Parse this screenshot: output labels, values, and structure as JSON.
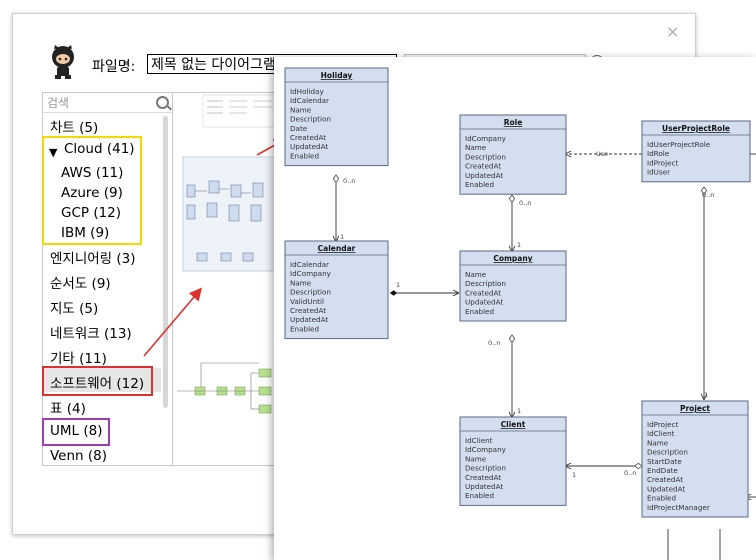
{
  "dialog": {
    "close_label": "×",
    "filename_label": "파일명:",
    "filename_value": "제목 없는 다이어그램"
  },
  "sidebar": {
    "search_placeholder": "검색",
    "items": [
      {
        "label": "차트 (5)"
      },
      {
        "label": "Cloud (41)",
        "expanded": true
      },
      {
        "label": "AWS (11)"
      },
      {
        "label": "Azure (9)"
      },
      {
        "label": "GCP (12)"
      },
      {
        "label": "IBM (9)"
      },
      {
        "label": "엔지니어링 (3)"
      },
      {
        "label": "순서도 (9)"
      },
      {
        "label": "지도 (5)"
      },
      {
        "label": "네트워크 (13)"
      },
      {
        "label": "기타 (11)"
      },
      {
        "label": "소프트웨어 (12)"
      },
      {
        "label": "표 (4)"
      },
      {
        "label": "UML (8)"
      },
      {
        "label": "Venn (8)"
      }
    ]
  },
  "colors": {
    "highlight_yellow": "#f5d800",
    "highlight_red": "#e0302e",
    "highlight_purple": "#9b3fb0",
    "entity_fill": "#d3deef",
    "entity_border": "#5a6a86",
    "arrow": "#e0302e"
  },
  "diagram": {
    "entities": [
      {
        "title": "Holiday",
        "attrs": [
          "IdHoliday",
          "IdCalendar",
          "Name",
          "Description",
          "Date",
          "CreatedAt",
          "UpdatedAt",
          "Enabled"
        ]
      },
      {
        "title": "Role",
        "attrs": [
          "IdCompany",
          "Name",
          "Description",
          "CreatedAt",
          "UpdatedAt",
          "Enabled"
        ]
      },
      {
        "title": "UserProjectRole",
        "attrs": [
          "IdUserProjectRole",
          "IdRole",
          "IdProject",
          "IdUser"
        ]
      },
      {
        "title": "Calendar",
        "attrs": [
          "IdCalendar",
          "IdCompany",
          "Name",
          "Description",
          "ValidUntil",
          "CreatedAt",
          "UpdatedAt",
          "Enabled"
        ]
      },
      {
        "title": "Company",
        "attrs": [
          "Name",
          "Description",
          "CreatedAt",
          "UpdatedAt",
          "Enabled"
        ]
      },
      {
        "title": "Client",
        "attrs": [
          "IdClient",
          "IdCompany",
          "Name",
          "Description",
          "CreatedAt",
          "UpdatedAt",
          "Enabled"
        ]
      },
      {
        "title": "Project",
        "attrs": [
          "IdProject",
          "IdClient",
          "Name",
          "Description",
          "StartDate",
          "EndDate",
          "CreatedAt",
          "UpdatedAt",
          "Enabled",
          "IdProjectManager"
        ]
      }
    ],
    "labels": {
      "use": "Use",
      "many": "0..n",
      "one": "1"
    }
  }
}
